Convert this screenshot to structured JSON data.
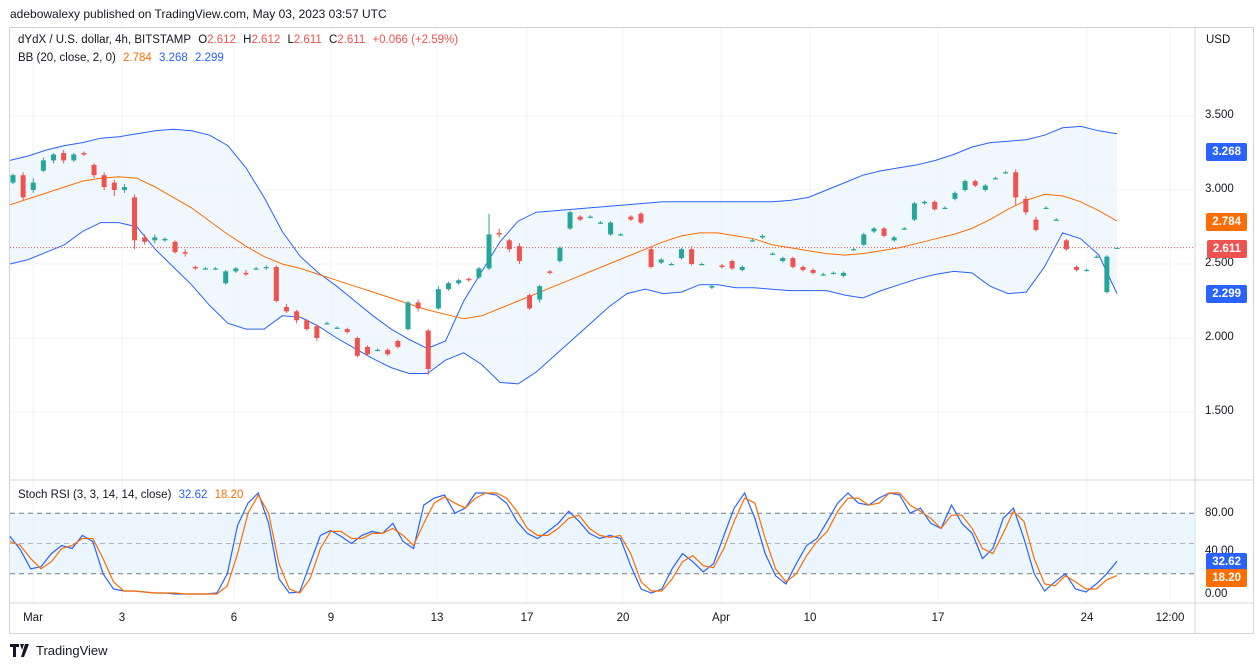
{
  "header": {
    "published_by": "adebowalexy published on TradingView.com, May 03, 2023 03:57 UTC"
  },
  "legend": {
    "symbol": "dYdX / U.S. dollar, 4h, BITSTAMP",
    "o_label": "O",
    "o": "2.612",
    "h_label": "H",
    "h": "2.612",
    "l_label": "L",
    "l": "2.611",
    "c_label": "C",
    "c": "2.611",
    "change": "+0.066 (+2.59%)",
    "bb_label": "BB (20, close, 2, 0)",
    "bb_basis": "2.784",
    "bb_upper": "3.268",
    "bb_lower": "2.299"
  },
  "currency": "USD",
  "price_badges": {
    "upper": "3.268",
    "basis": "2.784",
    "last": "2.611",
    "lower": "2.299"
  },
  "stoch": {
    "label": "Stoch RSI (3, 3, 14, 14, close)",
    "k": "32.62",
    "d": "18.20"
  },
  "stoch_badges": {
    "k": "32.62",
    "d": "18.20"
  },
  "footer": {
    "brand": "TradingView"
  },
  "colors": {
    "up": "#26a69a",
    "down": "#ef5350",
    "band": "#2962ff",
    "basis": "#ff6d00",
    "band_fill": "#e3f2fd"
  },
  "chart_data": [
    {
      "type": "candlestick",
      "title": "dYdX / U.S. dollar, 4h, BITSTAMP",
      "y_ticks": [
        "3.500",
        "3.000",
        "2.500",
        "2.000",
        "1.500"
      ],
      "ylim": [
        1.2,
        3.75
      ],
      "x_ticks": [
        "Mar",
        "3",
        "6",
        "9",
        "13",
        "17",
        "20",
        "Apr",
        "10",
        "17",
        "24",
        "12:00"
      ],
      "last_price": 2.611,
      "bb_upper": [
        3.2,
        3.23,
        3.27,
        3.3,
        3.32,
        3.35,
        3.36,
        3.38,
        3.4,
        3.41,
        3.4,
        3.37,
        3.3,
        3.15,
        2.95,
        2.72,
        2.55,
        2.44,
        2.35,
        2.25,
        2.15,
        2.06,
        1.99,
        1.93,
        1.98,
        2.25,
        2.45,
        2.65,
        2.79,
        2.85,
        2.86,
        2.87,
        2.88,
        2.89,
        2.9,
        2.91,
        2.92,
        2.92,
        2.92,
        2.92,
        2.92,
        2.92,
        2.92,
        2.93,
        2.95,
        3.0,
        3.05,
        3.1,
        3.13,
        3.15,
        3.17,
        3.2,
        3.24,
        3.29,
        3.32,
        3.33,
        3.34,
        3.37,
        3.42,
        3.43,
        3.4,
        3.38
      ],
      "bb_basis": [
        2.9,
        2.94,
        2.98,
        3.02,
        3.06,
        3.08,
        3.09,
        3.08,
        3.02,
        2.95,
        2.88,
        2.79,
        2.7,
        2.62,
        2.55,
        2.5,
        2.47,
        2.43,
        2.39,
        2.35,
        2.31,
        2.27,
        2.23,
        2.19,
        2.16,
        2.13,
        2.15,
        2.2,
        2.25,
        2.3,
        2.35,
        2.4,
        2.45,
        2.5,
        2.55,
        2.6,
        2.65,
        2.69,
        2.71,
        2.71,
        2.69,
        2.67,
        2.63,
        2.61,
        2.59,
        2.57,
        2.56,
        2.57,
        2.59,
        2.61,
        2.64,
        2.67,
        2.7,
        2.74,
        2.8,
        2.87,
        2.93,
        2.97,
        2.96,
        2.92,
        2.86,
        2.79
      ],
      "bb_lower": [
        2.5,
        2.53,
        2.58,
        2.63,
        2.72,
        2.78,
        2.78,
        2.75,
        2.6,
        2.48,
        2.36,
        2.22,
        2.1,
        2.06,
        2.06,
        2.15,
        2.14,
        2.08,
        2.0,
        1.93,
        1.86,
        1.8,
        1.76,
        1.76,
        1.85,
        1.9,
        1.82,
        1.7,
        1.69,
        1.77,
        1.88,
        1.99,
        2.1,
        2.21,
        2.3,
        2.33,
        2.3,
        2.31,
        2.36,
        2.36,
        2.34,
        2.34,
        2.33,
        2.32,
        2.32,
        2.32,
        2.29,
        2.27,
        2.32,
        2.36,
        2.4,
        2.43,
        2.45,
        2.44,
        2.35,
        2.3,
        2.31,
        2.48,
        2.71,
        2.67,
        2.56,
        2.3
      ],
      "candles": [
        [
          3.05,
          3.1,
          3.11,
          3.04
        ],
        [
          3.1,
          2.95,
          3.12,
          2.93
        ],
        [
          3.0,
          3.05,
          3.08,
          2.98
        ],
        [
          3.13,
          3.2,
          3.22,
          3.12
        ],
        [
          3.2,
          3.24,
          3.25,
          3.18
        ],
        [
          3.25,
          3.2,
          3.27,
          3.18
        ],
        [
          3.2,
          3.24,
          3.25,
          3.19
        ],
        [
          3.25,
          3.24,
          3.26,
          3.23
        ],
        [
          3.17,
          3.1,
          3.18,
          3.08
        ],
        [
          3.1,
          3.02,
          3.12,
          3.0
        ],
        [
          3.05,
          3.0,
          3.07,
          2.96
        ],
        [
          3.0,
          3.02,
          3.04,
          2.98
        ],
        [
          2.95,
          2.66,
          2.97,
          2.6
        ],
        [
          2.68,
          2.65,
          2.7,
          2.63
        ],
        [
          2.66,
          2.68,
          2.7,
          2.64
        ],
        [
          2.66,
          2.67,
          2.68,
          2.65
        ],
        [
          2.65,
          2.58,
          2.66,
          2.57
        ],
        [
          2.58,
          2.57,
          2.6,
          2.55
        ],
        [
          2.48,
          2.47,
          2.49,
          2.46
        ],
        [
          2.47,
          2.47,
          2.48,
          2.46
        ],
        [
          2.47,
          2.47,
          2.48,
          2.46
        ],
        [
          2.37,
          2.45,
          2.46,
          2.36
        ],
        [
          2.45,
          2.47,
          2.48,
          2.44
        ],
        [
          2.44,
          2.43,
          2.46,
          2.42
        ],
        [
          2.47,
          2.47,
          2.48,
          2.46
        ],
        [
          2.48,
          2.48,
          2.49,
          2.46
        ],
        [
          2.48,
          2.25,
          2.49,
          2.24
        ],
        [
          2.21,
          2.18,
          2.23,
          2.17
        ],
        [
          2.18,
          2.12,
          2.19,
          2.1
        ],
        [
          2.12,
          2.06,
          2.13,
          2.05
        ],
        [
          2.08,
          2.0,
          2.09,
          1.98
        ],
        [
          2.1,
          2.1,
          2.11,
          2.09
        ],
        [
          2.07,
          2.07,
          2.08,
          2.06
        ],
        [
          2.06,
          2.04,
          2.07,
          2.03
        ],
        [
          2.0,
          1.88,
          2.01,
          1.87
        ],
        [
          1.94,
          1.89,
          1.95,
          1.88
        ],
        [
          1.92,
          1.92,
          1.93,
          1.91
        ],
        [
          1.92,
          1.89,
          1.93,
          1.88
        ],
        [
          1.98,
          1.94,
          1.99,
          1.93
        ],
        [
          2.06,
          2.24,
          2.25,
          2.05
        ],
        [
          2.24,
          2.2,
          2.26,
          2.18
        ],
        [
          2.05,
          1.79,
          2.06,
          1.75
        ],
        [
          2.2,
          2.33,
          2.35,
          2.19
        ],
        [
          2.33,
          2.37,
          2.38,
          2.32
        ],
        [
          2.37,
          2.39,
          2.4,
          2.36
        ],
        [
          2.4,
          2.39,
          2.41,
          2.38
        ],
        [
          2.41,
          2.47,
          2.48,
          2.4
        ],
        [
          2.47,
          2.7,
          2.84,
          2.46
        ],
        [
          2.71,
          2.7,
          2.74,
          2.68
        ],
        [
          2.66,
          2.6,
          2.67,
          2.58
        ],
        [
          2.62,
          2.52,
          2.64,
          2.5
        ],
        [
          2.29,
          2.2,
          2.3,
          2.19
        ],
        [
          2.26,
          2.35,
          2.36,
          2.24
        ],
        [
          2.45,
          2.44,
          2.46,
          2.43
        ],
        [
          2.52,
          2.61,
          2.62,
          2.51
        ],
        [
          2.74,
          2.85,
          2.86,
          2.73
        ],
        [
          2.82,
          2.8,
          2.83,
          2.79
        ],
        [
          2.82,
          2.82,
          2.83,
          2.81
        ],
        [
          2.78,
          2.78,
          2.79,
          2.77
        ],
        [
          2.7,
          2.78,
          2.79,
          2.69
        ],
        [
          2.7,
          2.7,
          2.71,
          2.69
        ],
        [
          2.82,
          2.8,
          2.83,
          2.79
        ],
        [
          2.84,
          2.78,
          2.85,
          2.77
        ],
        [
          2.6,
          2.48,
          2.62,
          2.47
        ],
        [
          2.51,
          2.53,
          2.54,
          2.5
        ],
        [
          2.5,
          2.5,
          2.51,
          2.49
        ],
        [
          2.54,
          2.6,
          2.61,
          2.53
        ],
        [
          2.6,
          2.5,
          2.62,
          2.49
        ],
        [
          2.5,
          2.5,
          2.51,
          2.49
        ],
        [
          2.34,
          2.35,
          2.36,
          2.33
        ],
        [
          2.49,
          2.48,
          2.5,
          2.47
        ],
        [
          2.52,
          2.47,
          2.53,
          2.46
        ],
        [
          2.46,
          2.48,
          2.49,
          2.45
        ],
        [
          2.66,
          2.66,
          2.67,
          2.65
        ],
        [
          2.68,
          2.69,
          2.7,
          2.67
        ],
        [
          2.57,
          2.57,
          2.58,
          2.56
        ],
        [
          2.52,
          2.54,
          2.55,
          2.51
        ],
        [
          2.54,
          2.48,
          2.55,
          2.47
        ],
        [
          2.48,
          2.46,
          2.49,
          2.45
        ],
        [
          2.46,
          2.44,
          2.47,
          2.43
        ],
        [
          2.43,
          2.43,
          2.44,
          2.42
        ],
        [
          2.44,
          2.44,
          2.45,
          2.43
        ],
        [
          2.42,
          2.44,
          2.45,
          2.41
        ],
        [
          2.6,
          2.6,
          2.61,
          2.59
        ],
        [
          2.63,
          2.7,
          2.71,
          2.62
        ],
        [
          2.72,
          2.74,
          2.75,
          2.71
        ],
        [
          2.74,
          2.69,
          2.75,
          2.68
        ],
        [
          2.66,
          2.68,
          2.69,
          2.65
        ],
        [
          2.74,
          2.74,
          2.75,
          2.73
        ],
        [
          2.8,
          2.91,
          2.92,
          2.79
        ],
        [
          2.91,
          2.92,
          2.93,
          2.9
        ],
        [
          2.92,
          2.87,
          2.93,
          2.86
        ],
        [
          2.88,
          2.88,
          2.89,
          2.87
        ],
        [
          2.94,
          2.98,
          2.99,
          2.93
        ],
        [
          3.0,
          3.06,
          3.07,
          2.99
        ],
        [
          3.06,
          3.03,
          3.07,
          3.02
        ],
        [
          3.0,
          3.03,
          3.04,
          2.99
        ],
        [
          3.08,
          3.08,
          3.09,
          3.07
        ],
        [
          3.12,
          3.12,
          3.13,
          3.11
        ],
        [
          3.12,
          2.95,
          3.14,
          2.9
        ],
        [
          2.94,
          2.85,
          2.96,
          2.83
        ],
        [
          2.8,
          2.73,
          2.82,
          2.72
        ],
        [
          2.88,
          2.88,
          2.89,
          2.87
        ],
        [
          2.8,
          2.8,
          2.81,
          2.79
        ],
        [
          2.66,
          2.6,
          2.67,
          2.59
        ],
        [
          2.48,
          2.46,
          2.49,
          2.45
        ],
        [
          2.46,
          2.46,
          2.47,
          2.45
        ],
        [
          2.55,
          2.55,
          2.56,
          2.54
        ],
        [
          2.31,
          2.55,
          2.56,
          2.3
        ],
        [
          2.61,
          2.61,
          2.61,
          2.61
        ]
      ]
    },
    {
      "type": "line",
      "title": "Stoch RSI (3, 3, 14, 14, close)",
      "y_ticks": [
        "80.00",
        "40.00",
        "0.00"
      ],
      "ylim": [
        -6,
        108
      ],
      "series": [
        {
          "name": "K",
          "color": "#2962ff",
          "values": [
            57,
            44,
            25,
            27,
            40,
            48,
            45,
            58,
            52,
            20,
            5,
            3,
            3,
            2,
            1,
            1,
            0,
            0,
            0,
            0,
            1,
            20,
            68,
            90,
            100,
            70,
            15,
            1,
            2,
            30,
            58,
            63,
            57,
            50,
            58,
            62,
            60,
            70,
            52,
            45,
            88,
            95,
            98,
            80,
            85,
            100,
            100,
            98,
            90,
            72,
            60,
            55,
            62,
            70,
            82,
            72,
            60,
            55,
            58,
            55,
            28,
            5,
            1,
            5,
            25,
            40,
            32,
            22,
            30,
            58,
            85,
            100,
            75,
            40,
            18,
            10,
            30,
            48,
            55,
            72,
            90,
            100,
            90,
            88,
            95,
            100,
            98,
            80,
            85,
            70,
            65,
            88,
            70,
            60,
            35,
            45,
            75,
            85,
            55,
            20,
            3,
            12,
            20,
            5,
            2,
            10,
            20,
            32.62
          ]
        },
        {
          "name": "D",
          "color": "#ff6d00",
          "values": [
            52,
            48,
            35,
            25,
            32,
            45,
            48,
            55,
            55,
            35,
            12,
            3,
            3,
            2,
            1,
            1,
            1,
            0,
            0,
            0,
            0,
            8,
            40,
            80,
            98,
            80,
            30,
            5,
            1,
            15,
            45,
            62,
            62,
            55,
            55,
            60,
            60,
            65,
            58,
            48,
            70,
            90,
            96,
            90,
            85,
            95,
            100,
            100,
            95,
            82,
            65,
            58,
            58,
            65,
            75,
            78,
            65,
            58,
            56,
            58,
            40,
            12,
            3,
            3,
            15,
            32,
            38,
            28,
            26,
            45,
            72,
            95,
            90,
            55,
            25,
            12,
            20,
            38,
            52,
            62,
            82,
            95,
            95,
            88,
            90,
            100,
            100,
            88,
            82,
            75,
            65,
            78,
            78,
            65,
            45,
            40,
            60,
            82,
            72,
            35,
            10,
            8,
            18,
            12,
            5,
            5,
            14,
            18.2
          ]
        }
      ]
    }
  ]
}
